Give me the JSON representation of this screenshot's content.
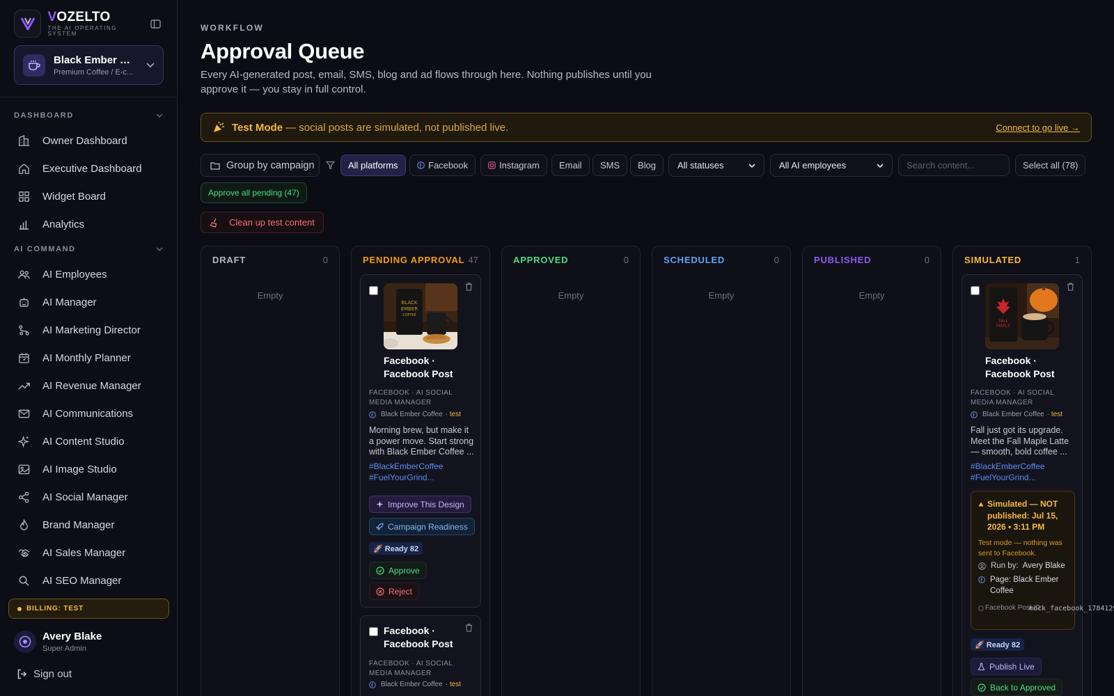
{
  "app": {
    "brand_first": "V",
    "brand_rest": "OZELTO",
    "tagline": "THE AI OPERATING SYSTEM"
  },
  "workspace": {
    "name": "Black Ember Co...",
    "subtitle": "Premium Coffee / E-c..."
  },
  "sidebar": {
    "sections": [
      {
        "label": "DASHBOARD",
        "items": [
          {
            "label": "Owner Dashboard",
            "icon": "building-icon"
          },
          {
            "label": "Executive Dashboard",
            "icon": "home-icon"
          },
          {
            "label": "Widget Board",
            "icon": "grid-icon"
          },
          {
            "label": "Analytics",
            "icon": "bar-chart-icon"
          }
        ]
      },
      {
        "label": "AI COMMAND",
        "items": [
          {
            "label": "AI Employees",
            "icon": "users-icon"
          },
          {
            "label": "AI Manager",
            "icon": "bot-icon"
          },
          {
            "label": "AI Marketing Director",
            "icon": "workflow-icon"
          },
          {
            "label": "AI Monthly Planner",
            "icon": "calendar-icon"
          },
          {
            "label": "AI Revenue Manager",
            "icon": "trending-up-icon"
          },
          {
            "label": "AI Communications",
            "icon": "mail-icon"
          },
          {
            "label": "AI Content Studio",
            "icon": "sparkles-icon"
          },
          {
            "label": "AI Image Studio",
            "icon": "image-icon"
          },
          {
            "label": "AI Social Manager",
            "icon": "share-icon"
          },
          {
            "label": "Brand Manager",
            "icon": "flame-icon"
          },
          {
            "label": "AI Sales Manager",
            "icon": "handshake-icon"
          },
          {
            "label": "AI SEO Manager",
            "icon": "search-icon"
          }
        ]
      }
    ],
    "billing": "BILLING: TEST",
    "user": {
      "name": "Avery Blake",
      "role": "Super Admin"
    },
    "signout": "Sign out"
  },
  "header": {
    "eyebrow": "WORKFLOW",
    "title": "Approval Queue",
    "description": "Every AI-generated post, email, SMS, blog and ad flows through here. Nothing publishes until you approve it — you stay in full control."
  },
  "banner": {
    "bold": "Test Mode",
    "text": "— social posts are simulated, not published live.",
    "link": "Connect to go live →",
    "color": "#f5b942"
  },
  "filters": {
    "group_by": "Group by campaign",
    "platforms": [
      "All platforms",
      "Facebook",
      "Instagram",
      "Email",
      "SMS",
      "Blog"
    ],
    "status_select": "All statuses",
    "employee_select": "All AI employees",
    "search_placeholder": "Search content...",
    "select_all": "Select all (78)",
    "approve_all": "Approve all pending (47)",
    "cleanup": "Clean up test content"
  },
  "columns": [
    {
      "name": "DRAFT",
      "count": "0",
      "empty": "Empty",
      "color": "#b7b9c6"
    },
    {
      "name": "PENDING APPROVAL",
      "count": "47",
      "color": "#f59e0b"
    },
    {
      "name": "APPROVED",
      "count": "0",
      "empty": "Empty",
      "color": "#4ade80"
    },
    {
      "name": "SCHEDULED",
      "count": "0",
      "empty": "Empty",
      "color": "#60a5fa"
    },
    {
      "name": "PUBLISHED",
      "count": "0",
      "empty": "Empty",
      "color": "#8b5cf6"
    },
    {
      "name": "SIMULATED",
      "count": "1",
      "color": "#f5b942"
    }
  ],
  "pending_cards": [
    {
      "title": "Facebook · Facebook Post",
      "meta": "FACEBOOK · AI SOCIAL MEDIA MANAGER",
      "page": "Black Ember Coffee",
      "tag": "· test",
      "body": "Morning brew, but make it a power move. Start strong with Black Ember Coffee ...",
      "hashtags": "#BlackEmberCoffee #FuelYourGrind...",
      "improve": "Improve This Design",
      "campaign": "Campaign Readiness",
      "ready": "🚀 Ready 82",
      "approve": "Approve",
      "reject": "Reject"
    },
    {
      "title": "Facebook · Facebook Post",
      "meta": "FACEBOOK · AI SOCIAL MEDIA MANAGER",
      "page": "Black Ember Coffee",
      "tag": "· test"
    }
  ],
  "simulated_card": {
    "title": "Facebook · Facebook Post",
    "meta": "FACEBOOK · AI SOCIAL MEDIA MANAGER",
    "page": "Black Ember Coffee",
    "tag": "· test",
    "body": "Fall just got its upgrade. Meet the Fall Maple Latte — smooth, bold coffee ...",
    "hashtags": "#BlackEmberCoffee #FuelYourGrind...",
    "sim_title": "Simulated — NOT published: Jul 15, 2026 • 3:11 PM",
    "sim_note": "Test mode — nothing was sent to Facebook.",
    "run_by_label": "Run by:",
    "run_by": "Avery Blake",
    "page_line": "Page: Black Ember Coffee",
    "post_id_label": "Facebook Post ID:",
    "post_id": "mock_facebook_1784129",
    "ready": "🚀 Ready 82",
    "publish": "Publish Live",
    "back": "Back to Approved"
  }
}
